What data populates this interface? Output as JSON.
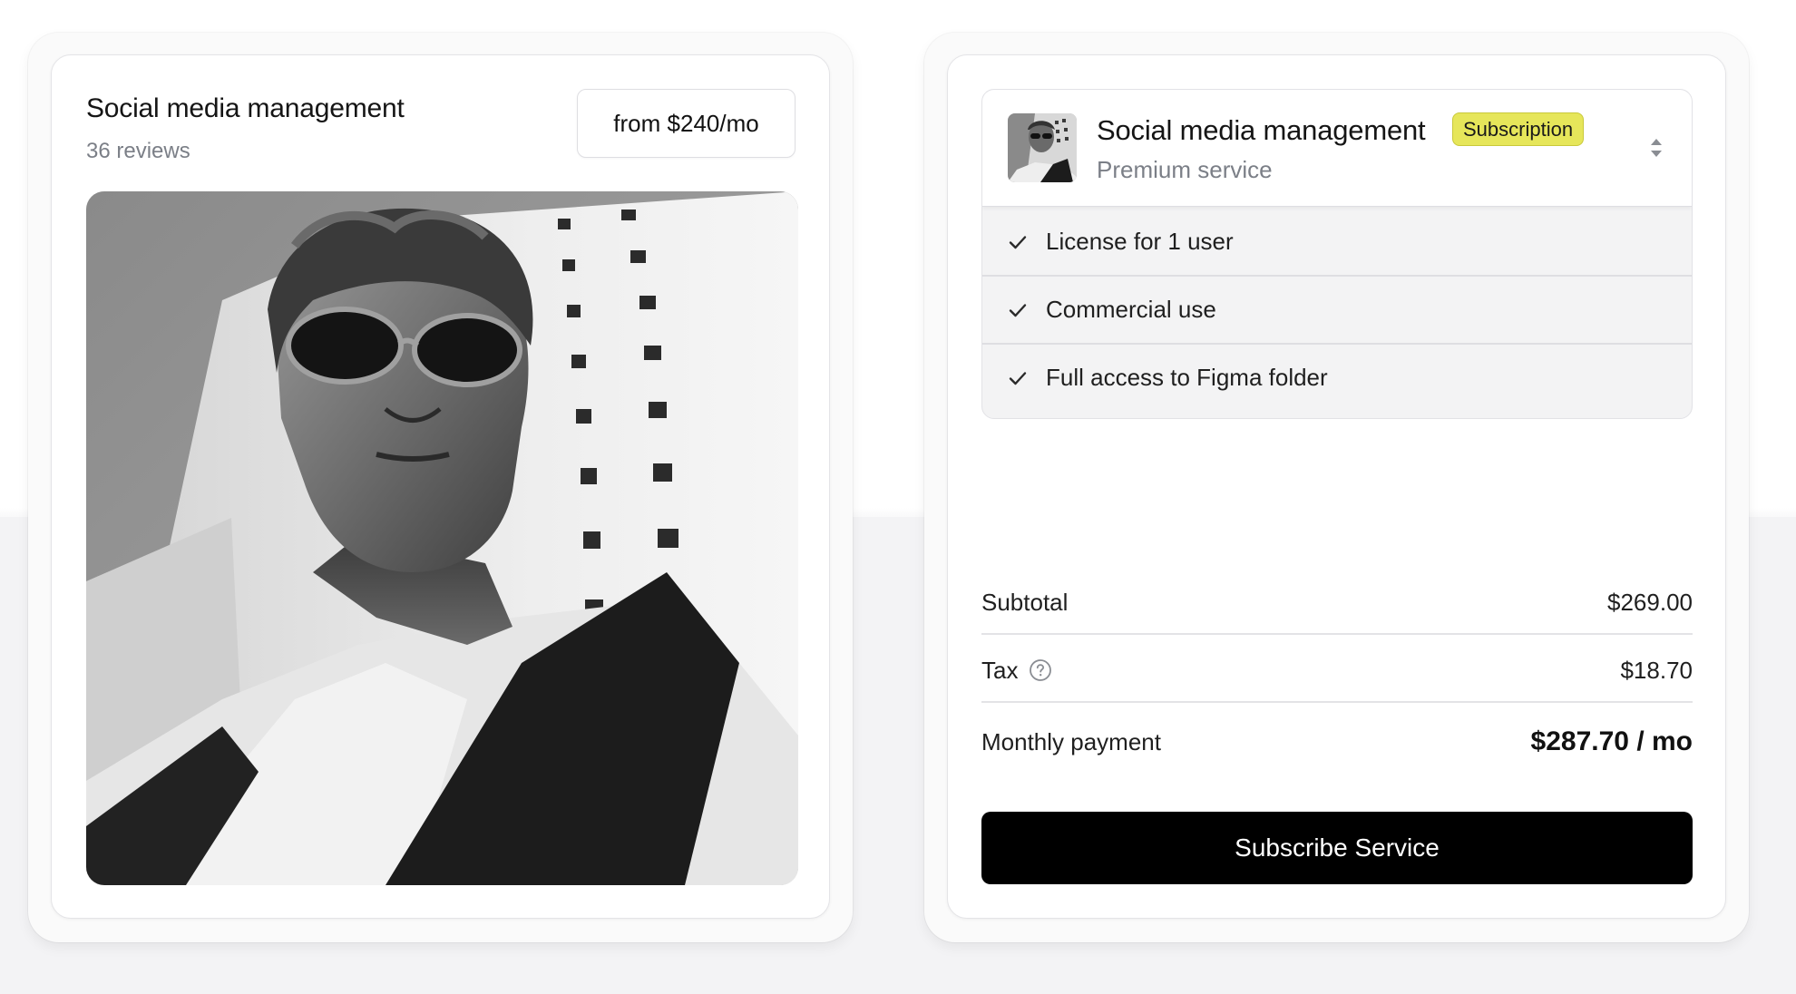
{
  "service_card": {
    "title": "Social media management",
    "reviews": "36 reviews",
    "price_button_label": "from $240/mo"
  },
  "checkout_card": {
    "product": {
      "title": "Social media management",
      "badge": "Subscription",
      "subtitle": "Premium service"
    },
    "features": [
      {
        "label": "License for 1 user"
      },
      {
        "label": "Commercial use"
      },
      {
        "label": "Full access to Figma folder"
      }
    ],
    "summary": {
      "subtotal_label": "Subtotal",
      "subtotal_value": "$269.00",
      "tax_label": "Tax",
      "tax_value": "$18.70",
      "total_label": "Monthly payment",
      "total_value": "$287.70 / mo"
    },
    "cta_label": "Subscribe Service"
  },
  "colors": {
    "badge_bg": "#e6e65a",
    "cta_bg": "#000000",
    "muted_text": "#7b7f87",
    "page_bg": "#f3f3f5"
  },
  "icons": {
    "feature": "check-icon",
    "selector": "chevron-up-down-icon",
    "tax_info": "question-circle-icon"
  }
}
